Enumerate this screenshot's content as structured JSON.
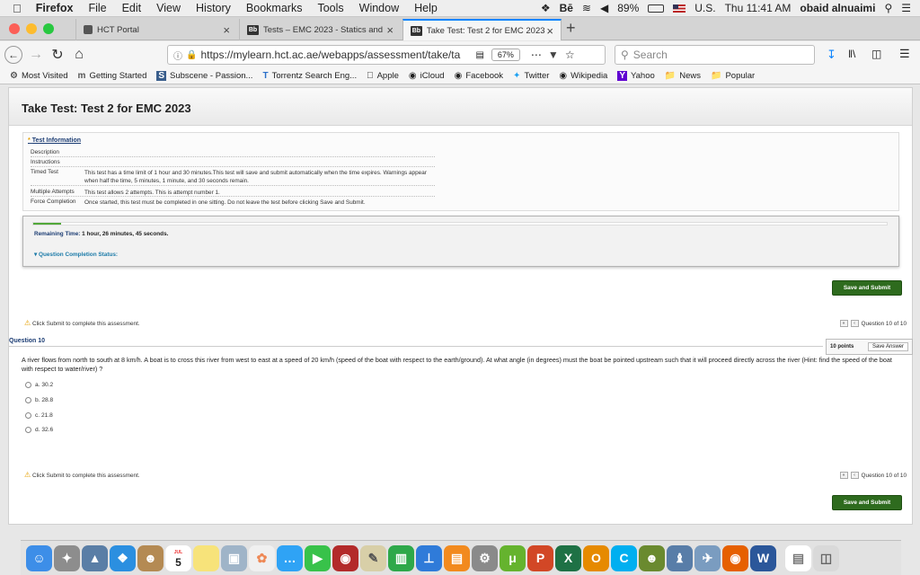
{
  "menubar": {
    "apple": "",
    "app": "Firefox",
    "items": [
      "File",
      "Edit",
      "View",
      "History",
      "Bookmarks",
      "Tools",
      "Window",
      "Help"
    ],
    "battery": "89%",
    "locale": "U.S.",
    "clock": "Thu 11:41 AM",
    "user": "obaid alnuaimi",
    "be": "Bē"
  },
  "tabs": [
    {
      "label": "HCT Portal"
    },
    {
      "label": "Tests – EMC 2023 - Statics and I",
      "icon": "Bb"
    },
    {
      "label": "Take Test: Test 2 for EMC 2023 -",
      "icon": "Bb"
    }
  ],
  "navbar": {
    "url": "https://mylearn.hct.ac.ae/webapps/assessment/take/ta",
    "zoom": "67%",
    "search_placeholder": "Search"
  },
  "bookmarks": [
    "Most Visited",
    "Getting Started",
    "Subscene - Passion...",
    "Torrentz Search Eng...",
    "Apple",
    "iCloud",
    "Facebook",
    "Twitter",
    "Wikipedia",
    "Yahoo",
    "News",
    "Popular"
  ],
  "page": {
    "title": "Take Test: Test 2 for EMC 2023",
    "info": {
      "heading": "Test Information",
      "rows": [
        {
          "label": "Description",
          "value": ""
        },
        {
          "label": "Instructions",
          "value": ""
        },
        {
          "label": "Timed Test",
          "value": "This test has a time limit of 1 hour and 30 minutes.This test will save and submit automatically when the time expires. Warnings appear when half the time, 5 minutes, 1 minute, and 30 seconds remain."
        },
        {
          "label": "Multiple Attempts",
          "value": "This test allows 2 attempts. This is attempt number 1."
        },
        {
          "label": "Force Completion",
          "value": "Once started, this test must be completed in one sitting. Do not leave the test before clicking Save and Submit."
        }
      ]
    },
    "timer": {
      "label": "Remaining Time:",
      "value": "1 hour, 26 minutes, 45 seconds.",
      "progress": 0.033
    },
    "completion_status": "Question Completion Status:",
    "save_submit": "Save and Submit",
    "click_submit": "Click Submit to complete this assessment.",
    "question_nav": "Question 10 of 10",
    "question": {
      "title": "Question 10",
      "points": "10 points",
      "save_answer": "Save Answer",
      "text": "A river flows from north to south at 8 km/h. A boat is to cross this river from west to east at a speed of 20 km/h (speed of the boat with respect to the earth/ground). At what angle (in degrees) must the boat be pointed upstream such that it will proceed directly across the river (Hint: find the speed of the boat with respect to water/river) ?",
      "options": [
        "a. 30.2",
        "b. 28.8",
        "c. 21.8",
        "d. 32.6"
      ]
    }
  },
  "dock": {
    "calendar_day": "5",
    "calendar_month": "JUL"
  }
}
